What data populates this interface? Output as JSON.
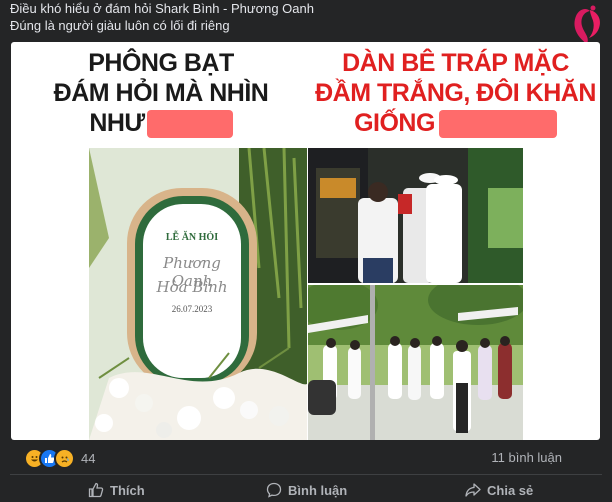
{
  "post": {
    "line1": "Điều khó hiểu ở đám hỏi Shark Bình - Phương Oanh",
    "line2": "Đúng là người giàu luôn có lối đi riêng"
  },
  "image": {
    "left_heading": [
      "PHÔNG BẠT",
      "ĐÁM HỎI MÀ NHÌN",
      "NHƯ"
    ],
    "right_heading": [
      "DÀN BÊ TRÁP MẶC",
      "ĐẦM TRẮNG, ĐÔI KHĂN",
      "GIỐNG"
    ],
    "sign": {
      "title": "LỄ ĂN HỎI",
      "names": [
        "Phương Oanh",
        "Hòa Bình"
      ],
      "date": "26.07.2023"
    }
  },
  "stats": {
    "reaction_count": "44",
    "comments": "11 bình luận",
    "reaction_icons": [
      "haha-icon",
      "like-icon",
      "sad-icon"
    ]
  },
  "actions": {
    "like": "Thích",
    "comment": "Bình luận",
    "share": "Chia sẻ"
  },
  "colors": {
    "background": "#242526",
    "heading_red": "#e02020",
    "redaction": "#ff6b6b"
  }
}
